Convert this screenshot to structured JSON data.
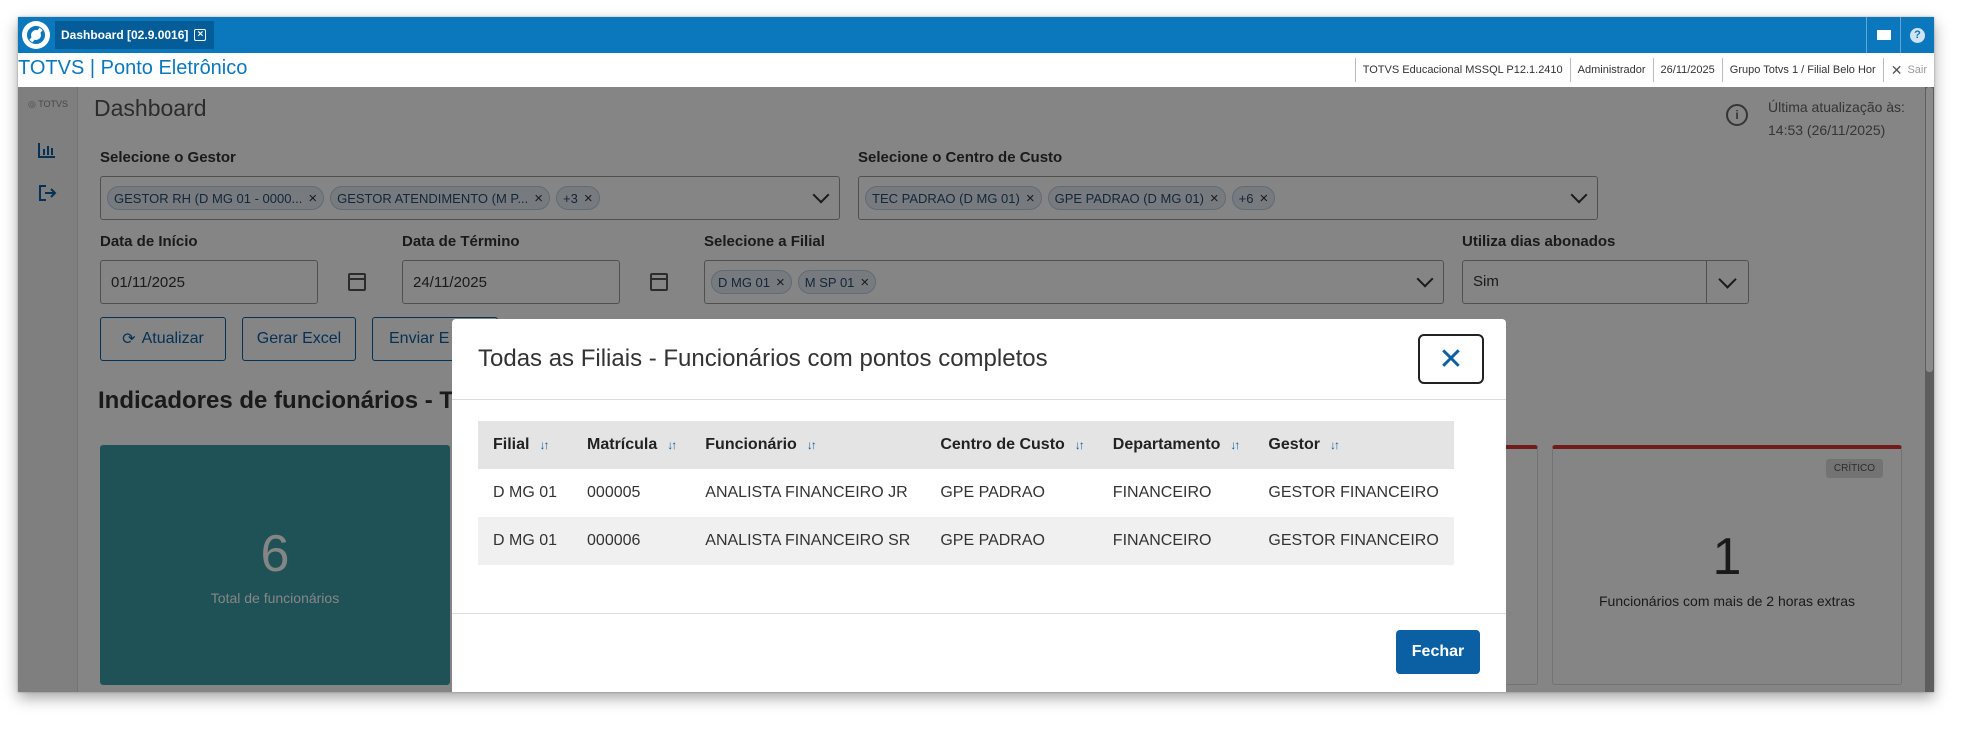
{
  "window": {
    "tab_label": "Dashboard [02.9.0016]",
    "app_title": "TOTVS | Ponto Eletrônico"
  },
  "sysinfo": {
    "environment": "TOTVS Educacional MSSQL P12.1.2410",
    "user": "Administrador",
    "date": "26/11/2025",
    "branch": "Grupo Totvs 1 / Filial Belo Hor",
    "logout_label": "Sair"
  },
  "sidebar": {
    "logo_text": "TOTVS",
    "items": [
      "chart-icon",
      "exit-icon"
    ]
  },
  "dashboard": {
    "title": "Dashboard",
    "last_update_label": "Última atualização às:",
    "last_update_value": "14:53 (26/11/2025)",
    "gestor_label": "Selecione o Gestor",
    "gestor_chips": [
      "GESTOR RH (D MG 01 - 0000...",
      "GESTOR ATENDIMENTO (M P...",
      "+3"
    ],
    "centro_label": "Selecione o Centro de Custo",
    "centro_chips": [
      "TEC PADRAO (D MG 01)",
      "GPE PADRAO (D MG 01)",
      "+6"
    ],
    "data_inicio_label": "Data de Início",
    "data_inicio_value": "01/11/2025",
    "data_termino_label": "Data de Término",
    "data_termino_value": "24/11/2025",
    "filial_label": "Selecione a Filial",
    "filial_chips": [
      "D MG 01",
      "M SP 01"
    ],
    "abonados_label": "Utiliza dias abonados",
    "abonados_value": "Sim",
    "btn_atualizar": "Atualizar",
    "btn_excel": "Gerar Excel",
    "btn_enviar": "Enviar E",
    "indicadores_title": "Indicadores de funcionários - Toc",
    "card_total_value": "6",
    "card_total_label": "Total de funcionários",
    "card_extras_badge": "CRÍTICO",
    "card_extras_value": "1",
    "card_extras_label": "Funcionários com mais de 2 horas extras"
  },
  "modal": {
    "title": "Todas as Filiais - Funcionários com pontos completos",
    "columns": [
      "Filial",
      "Matrícula",
      "Funcionário",
      "Centro de Custo",
      "Departamento",
      "Gestor"
    ],
    "rows": [
      [
        "D MG 01",
        "000005",
        "ANALISTA FINANCEIRO JR",
        "GPE PADRAO",
        "FINANCEIRO",
        "GESTOR FINANCEIRO"
      ],
      [
        "D MG 01",
        "000006",
        "ANALISTA FINANCEIRO SR",
        "GPE PADRAO",
        "FINANCEIRO",
        "GESTOR FINANCEIRO"
      ]
    ],
    "close_button": "Fechar"
  }
}
